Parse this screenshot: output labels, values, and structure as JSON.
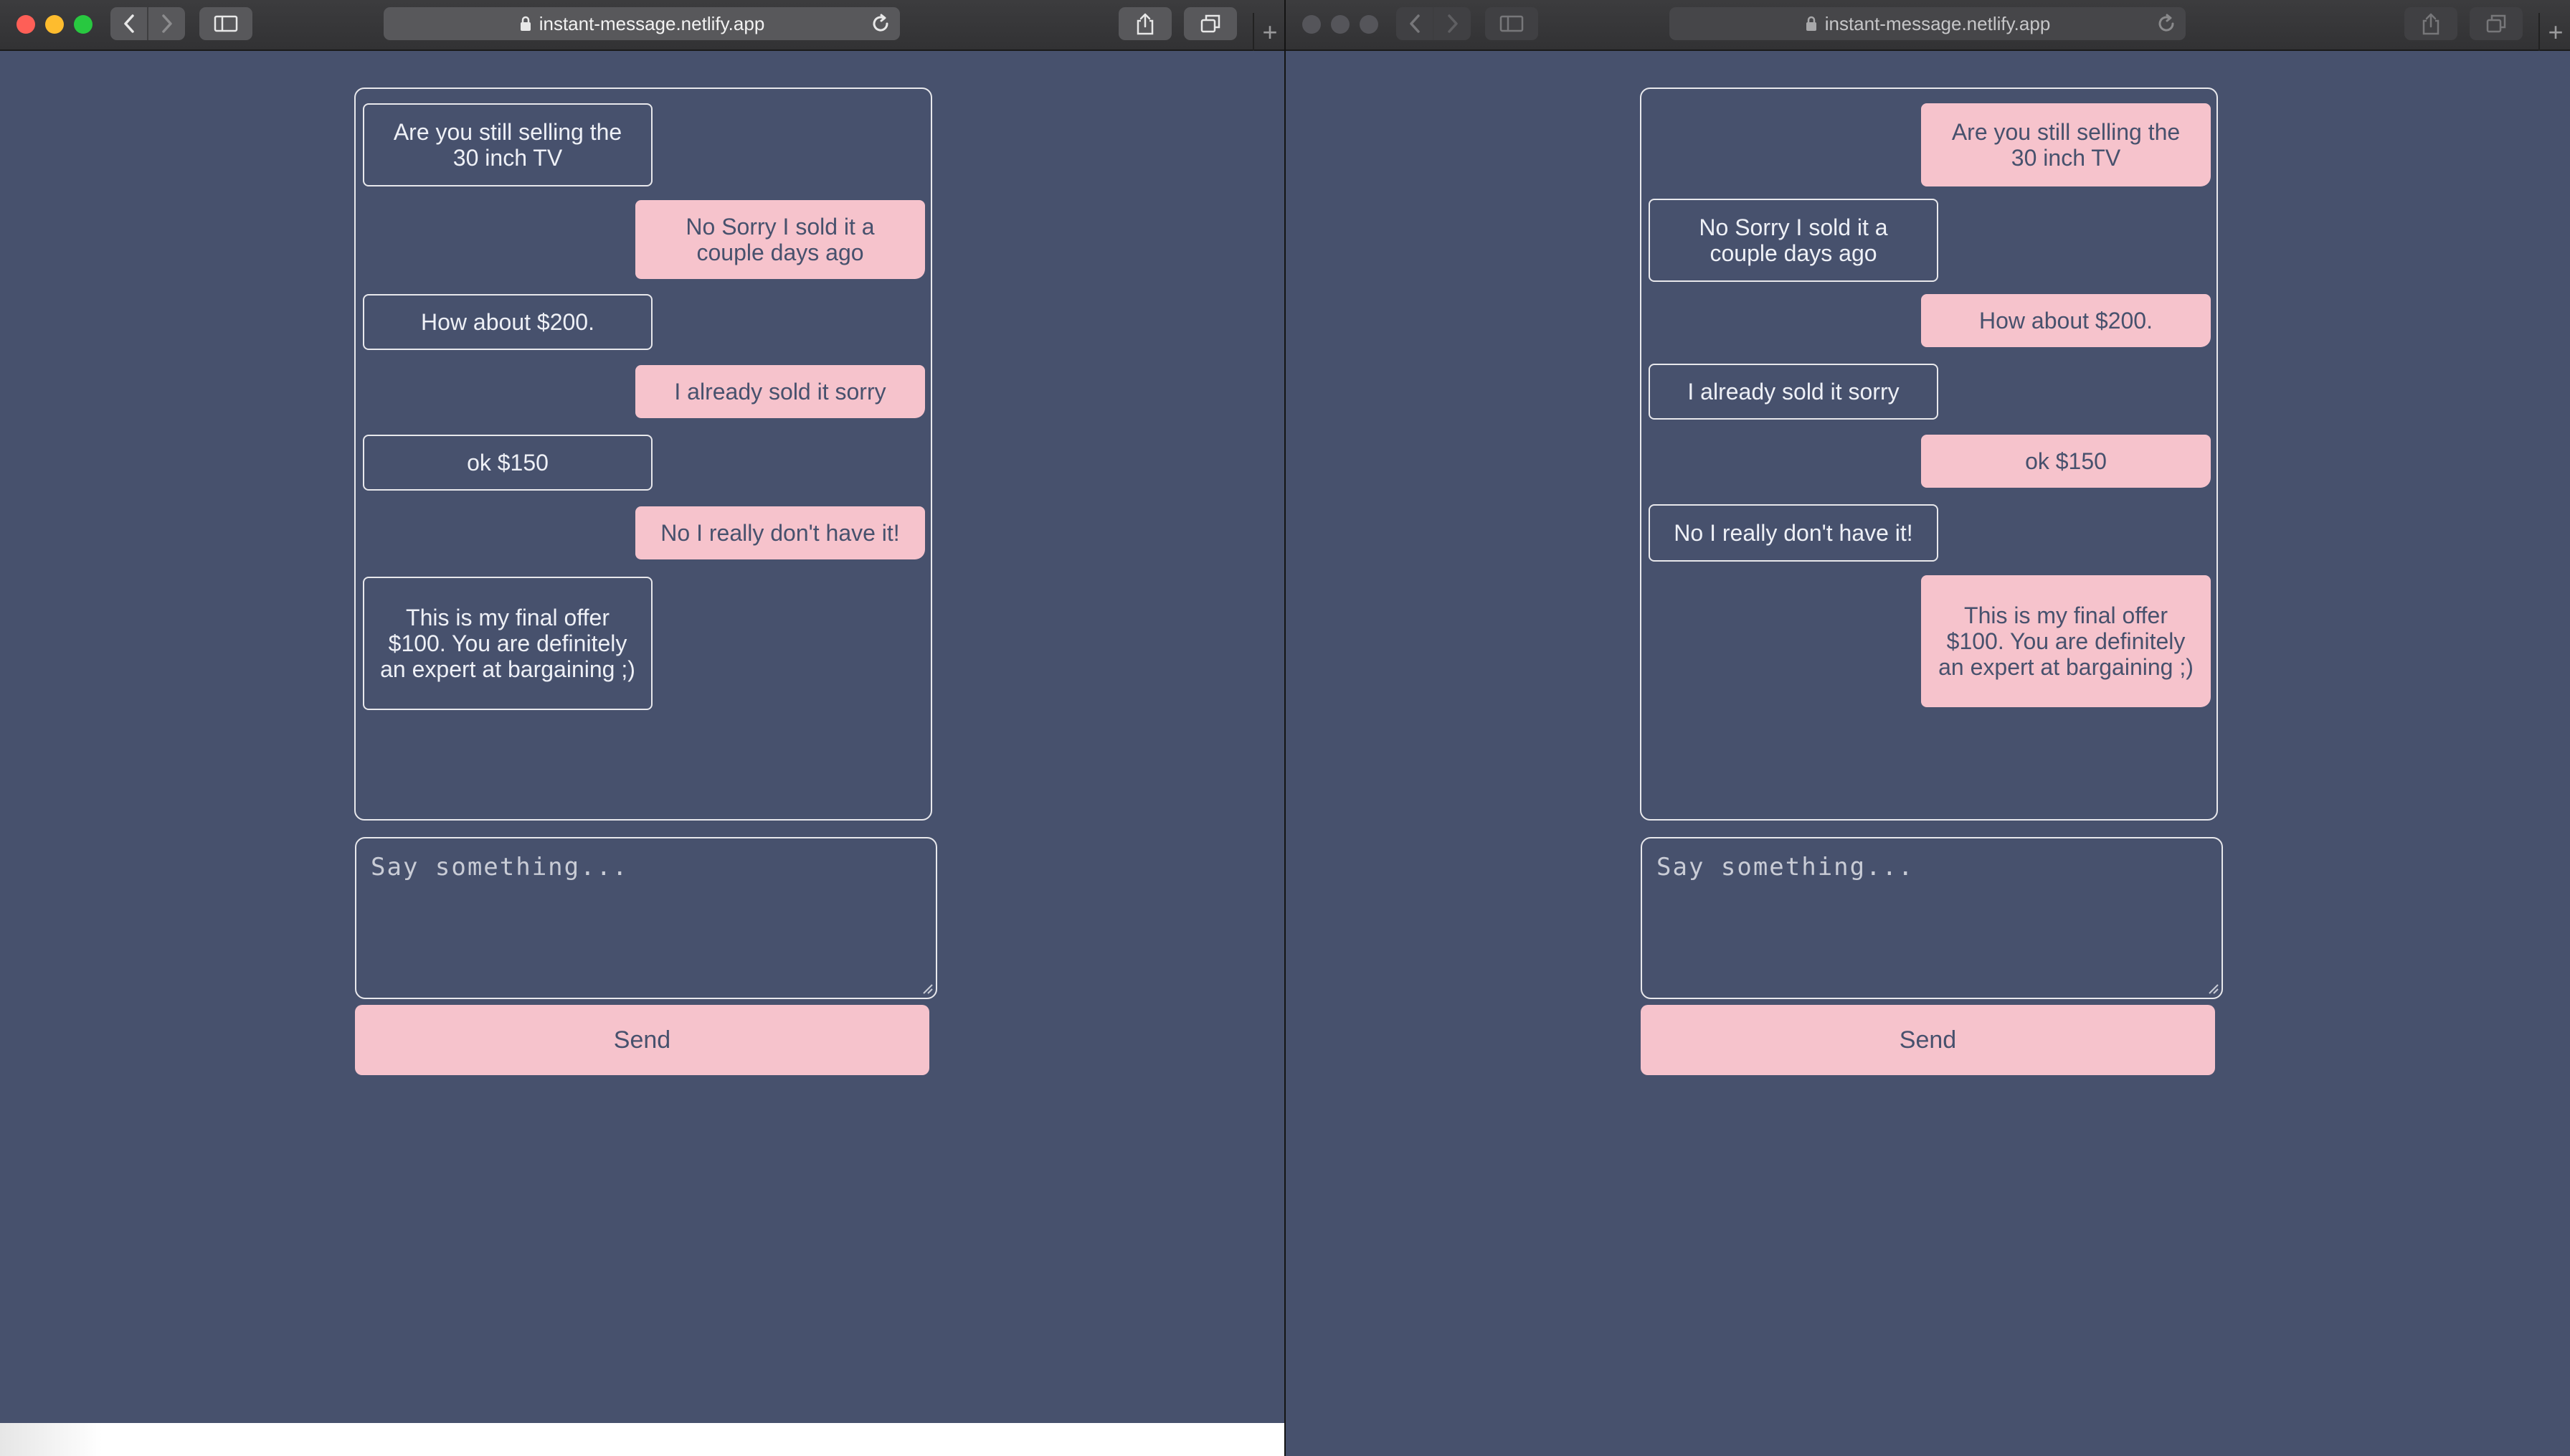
{
  "browser": {
    "url": "instant-message.netlify.app",
    "new_tab_label": "+"
  },
  "message_input": {
    "placeholder": "Say something..."
  },
  "send_button": {
    "label": "Send"
  },
  "colors": {
    "background": "#47516d",
    "bubble_fill": "#f6c3cc",
    "bubble_text": "#47516d",
    "outline": "#e8e8ec"
  },
  "windows": [
    {
      "id": "left",
      "active": true,
      "messages": [
        {
          "text": "Are you still selling the 30 inch TV",
          "style": "outline",
          "side": "left"
        },
        {
          "text": "No Sorry I sold it a couple days ago",
          "style": "filled",
          "side": "right"
        },
        {
          "text": "How about $200.",
          "style": "outline",
          "side": "left"
        },
        {
          "text": "I already sold it sorry",
          "style": "filled",
          "side": "right"
        },
        {
          "text": "ok $150",
          "style": "outline",
          "side": "left"
        },
        {
          "text": "No I really don't have it!",
          "style": "filled",
          "side": "right"
        },
        {
          "text": "This is my final offer $100. You are definitely an expert at bargaining ;)",
          "style": "outline",
          "side": "left"
        }
      ]
    },
    {
      "id": "right",
      "active": false,
      "messages": [
        {
          "text": "Are you still selling the 30 inch TV",
          "style": "filled",
          "side": "right"
        },
        {
          "text": "No Sorry I sold it a couple days ago",
          "style": "outline",
          "side": "left"
        },
        {
          "text": "How about $200.",
          "style": "filled",
          "side": "right"
        },
        {
          "text": "I already sold it sorry",
          "style": "outline",
          "side": "left"
        },
        {
          "text": "ok $150",
          "style": "filled",
          "side": "right"
        },
        {
          "text": "No I really don't have it!",
          "style": "outline",
          "side": "left"
        },
        {
          "text": "This is my final offer $100. You are definitely an expert at bargaining ;)",
          "style": "filled",
          "side": "right"
        }
      ]
    }
  ]
}
